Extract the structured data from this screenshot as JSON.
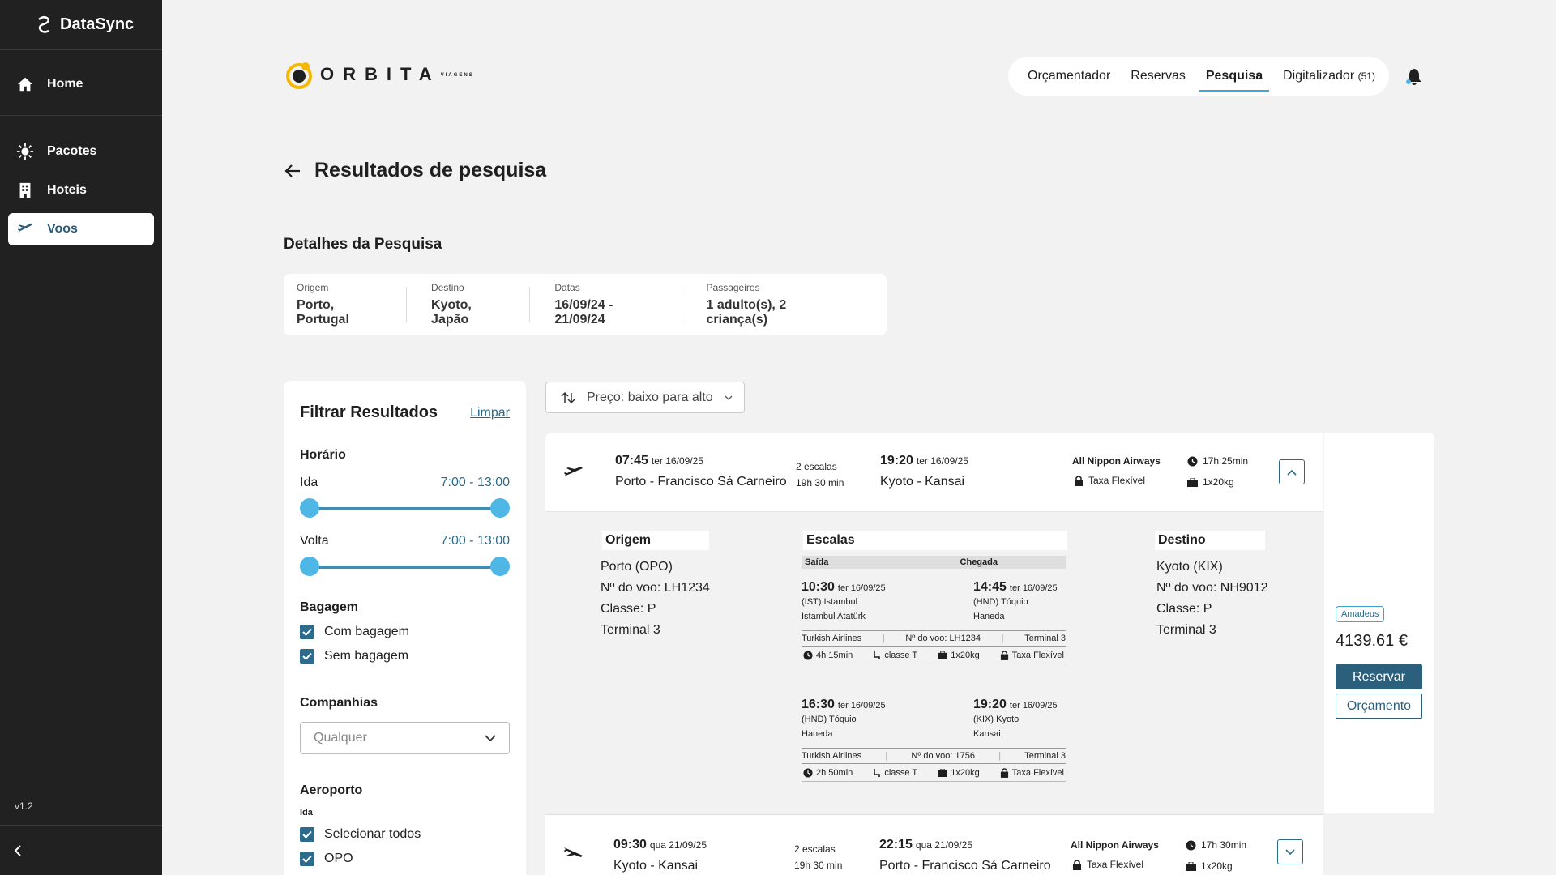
{
  "sidebar": {
    "brand": "DataSync",
    "items": [
      {
        "label": "Home",
        "icon": "home-icon"
      },
      {
        "label": "Pacotes",
        "icon": "sun-icon"
      },
      {
        "label": "Hoteis",
        "icon": "building-icon"
      },
      {
        "label": "Voos",
        "icon": "plane-icon"
      }
    ],
    "version": "v1.2"
  },
  "header": {
    "logo_text": "ORBITA",
    "logo_sub": "VIAGENS",
    "tabs": [
      {
        "label": "Orçamentador"
      },
      {
        "label": "Reservas"
      },
      {
        "label": "Pesquisa"
      },
      {
        "label": "Digitalizador",
        "count": "(51)"
      }
    ],
    "active_tab": "Pesquisa"
  },
  "page": {
    "title": "Resultados de pesquisa",
    "details_title": "Detalhes da Pesquisa"
  },
  "search": {
    "origem_label": "Origem",
    "origem": "Porto, Portugal",
    "destino_label": "Destino",
    "destino": "Kyoto, Japão",
    "datas_label": "Datas",
    "datas": "16/09/24 - 21/09/24",
    "passageiros_label": "Passageiros",
    "passageiros": "1 adulto(s), 2 criança(s)"
  },
  "filters": {
    "title": "Filtrar Resultados",
    "clear": "Limpar",
    "horario": "Horário",
    "ida": "Ida",
    "ida_range": "7:00 - 13:00",
    "volta": "Volta",
    "volta_range": "7:00 - 13:00",
    "bagagem": "Bagagem",
    "com_bagagem": "Com bagagem",
    "sem_bagagem": "Sem bagagem",
    "companhias": "Companhias",
    "companhias_value": "Qualquer",
    "aeroporto": "Aeroporto",
    "aeroporto_ida": "Ida",
    "selecionar_todos": "Selecionar todos",
    "opo": "OPO"
  },
  "sort": {
    "label": "Preço: baixo para alto"
  },
  "flight1": {
    "dep_time": "07:45",
    "dep_date": "ter 16/09/25",
    "dep_place": "Porto - Francisco Sá Carneiro",
    "stops": "2 escalas",
    "total": "19h 30 min",
    "arr_time": "19:20",
    "arr_date": "ter 16/09/25",
    "arr_place": "Kyoto  - Kansai",
    "airline": "All Nippon Airways",
    "fare": "Taxa Flexível",
    "duration": "17h 25min",
    "bags": "1x20kg"
  },
  "detail": {
    "origem_title": "Origem",
    "origem_lines": [
      "Porto (OPO)",
      "Nº do voo: LH1234",
      "Classe: P",
      "Terminal 3"
    ],
    "escalas_title": "Escalas",
    "saida": "Saída",
    "chegada": "Chegada",
    "destino_title": "Destino",
    "destino_lines": [
      "Kyoto (KIX)",
      "Nº do voo: NH9012",
      "Classe: P",
      "Terminal 3"
    ],
    "seg1": {
      "dep_time": "10:30",
      "dep_date": "ter 16/09/25",
      "dep_place1": "(IST) Istambul",
      "dep_place2": "Istambul Atatürk",
      "arr_time": "14:45",
      "arr_date": "ter 16/09/25",
      "arr_place1": "(HND) Tóquio",
      "arr_place2": "Haneda",
      "airline": "Turkish Airlines",
      "flight": "Nº do voo: LH1234",
      "terminal": "Terminal 3",
      "dur": "4h 15min",
      "class": "classe T",
      "bag": "1x20kg",
      "fare": "Taxa Flexível"
    },
    "seg2": {
      "dep_time": "16:30",
      "dep_date": "ter 16/09/25",
      "dep_place1": "(HND) Tóquio",
      "dep_place2": "Haneda",
      "arr_time": "19:20",
      "arr_date": "ter 16/09/25",
      "arr_place1": "(KIX) Kyoto",
      "arr_place2": "Kansai",
      "airline": "Turkish Airlines",
      "flight": "Nº do voo: 1756",
      "terminal": "Terminal 3",
      "dur": "2h 50min",
      "class": "classe T",
      "bag": "1x20kg",
      "fare": "Taxa Flexível"
    }
  },
  "pricing": {
    "provider": "Amadeus",
    "price": "4139.61 €",
    "reserve": "Reservar",
    "quote": "Orçamento"
  },
  "flight2": {
    "dep_time": "09:30",
    "dep_date": "qua 21/09/25",
    "dep_place": "Kyoto  - Kansai",
    "stops": "2 escalas",
    "total": "19h 30 min",
    "arr_time": "22:15",
    "arr_date": "qua 21/09/25",
    "arr_place": "Porto - Francisco Sá Carneiro",
    "airline": "All Nippon Airways",
    "fare": "Taxa Flexível",
    "duration": "17h 30min",
    "bags": "1x20kg"
  },
  "colors": {
    "sidebar": "#212121",
    "primary": "#2b5f7c",
    "accent": "#4fb7e6",
    "logo": "#f5b800"
  }
}
